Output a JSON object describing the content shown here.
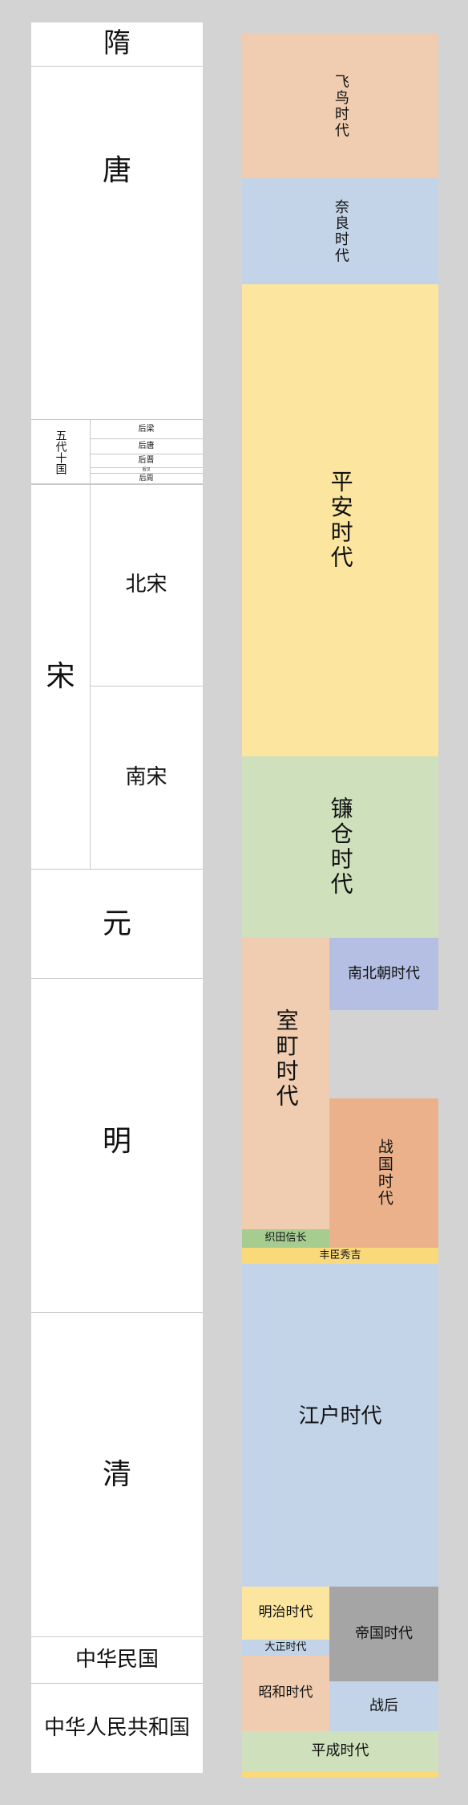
{
  "china": {
    "sui": "隋",
    "tang": "唐",
    "wudai": "五代十国",
    "houliang": "后梁",
    "houtang": "后唐",
    "houjin": "后晋",
    "houhan": "后汉",
    "houzhou": "后周",
    "song": "宋",
    "beisong": "北宋",
    "nansong": "南宋",
    "yuan": "元",
    "ming": "明",
    "qing": "清",
    "minguo": "中华民国",
    "prc": "中华人民共和国"
  },
  "japan": {
    "asuka": "飞鸟时代",
    "nara": "奈良时代",
    "heian": "平安时代",
    "kamakura": "镰仓时代",
    "muromachi": "室町时代",
    "nanbokucho": "南北朝时代",
    "sengoku": "战国时代",
    "oda": "织田信长",
    "toyotomi": "丰臣秀吉",
    "edo": "江户时代",
    "meiji": "明治时代",
    "taisho": "大正时代",
    "showa": "昭和时代",
    "teikoku": "帝国时代",
    "sengo": "战后",
    "heisei": "平成时代"
  },
  "colors": {
    "background": "#d3d3d3",
    "asuka": "#f0cdb0",
    "nara": "#c3d4e8",
    "heian": "#fbe59f",
    "kamakura": "#cfe0bc",
    "muromachi": "#f0cdb0",
    "nanbokucho": "#b4bfe3",
    "sengoku": "#ebb18b",
    "oda": "#a6cc90",
    "toyotomi": "#fad97a",
    "edo": "#c3d4e8",
    "meiji": "#fbe59f",
    "taisho": "#c3d4e8",
    "showa": "#f0cdb0",
    "teikoku": "#a5a5a5",
    "sengo": "#c3d4e8",
    "heisei": "#cfe0bc",
    "reiwa": "#fad97a"
  }
}
